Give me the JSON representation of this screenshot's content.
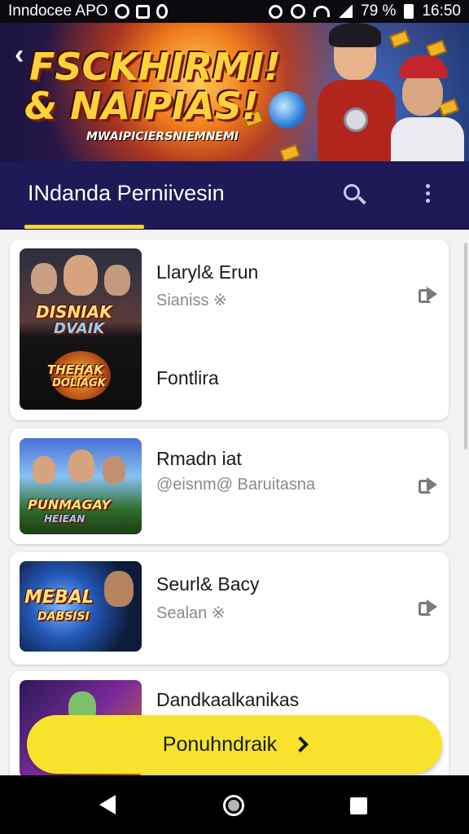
{
  "status_bar": {
    "app_name": "Inndocee APO",
    "battery": "79 %",
    "time": "16:50"
  },
  "banner": {
    "title_line1": "FSCKHIRMI!",
    "title_line2": "& NAIPIAS!",
    "subtitle": "MWAIPICIERSNIEMNEMI"
  },
  "app_bar": {
    "title": "INdanda Perniivesin"
  },
  "items": [
    {
      "name": "Llaryl& Erun",
      "sub": "Sianiss ※",
      "extra": "Fontlira",
      "thumb_line1": "DISNIAK",
      "thumb_line2": "DVAIK",
      "thumb_line3": "THEHAK",
      "thumb_line4": "DOLIAGK"
    },
    {
      "name": "Rmadn iat",
      "sub": "@eisnm@ Baruitasna",
      "thumb_line1": "PUNMAGAY",
      "thumb_line2": "HEIEAN"
    },
    {
      "name": "Seurl& Bacy",
      "sub": "Sealan ※",
      "thumb_line1": "MEBAL",
      "thumb_line2": "DABSISI"
    },
    {
      "name": "Dandkaalkanikas"
    }
  ],
  "cta": {
    "label": "Ponuhndraik"
  },
  "colors": {
    "app_bar": "#1d1a57",
    "accent_yellow": "#f7e32c",
    "tab_indicator": "#f4d534",
    "list_background": "#f2f2f5"
  },
  "icons": [
    "back-icon",
    "search-icon",
    "more-vert-icon",
    "share-icon",
    "chevron-right-icon",
    "nav-back-icon",
    "nav-home-icon",
    "nav-recents-icon"
  ]
}
